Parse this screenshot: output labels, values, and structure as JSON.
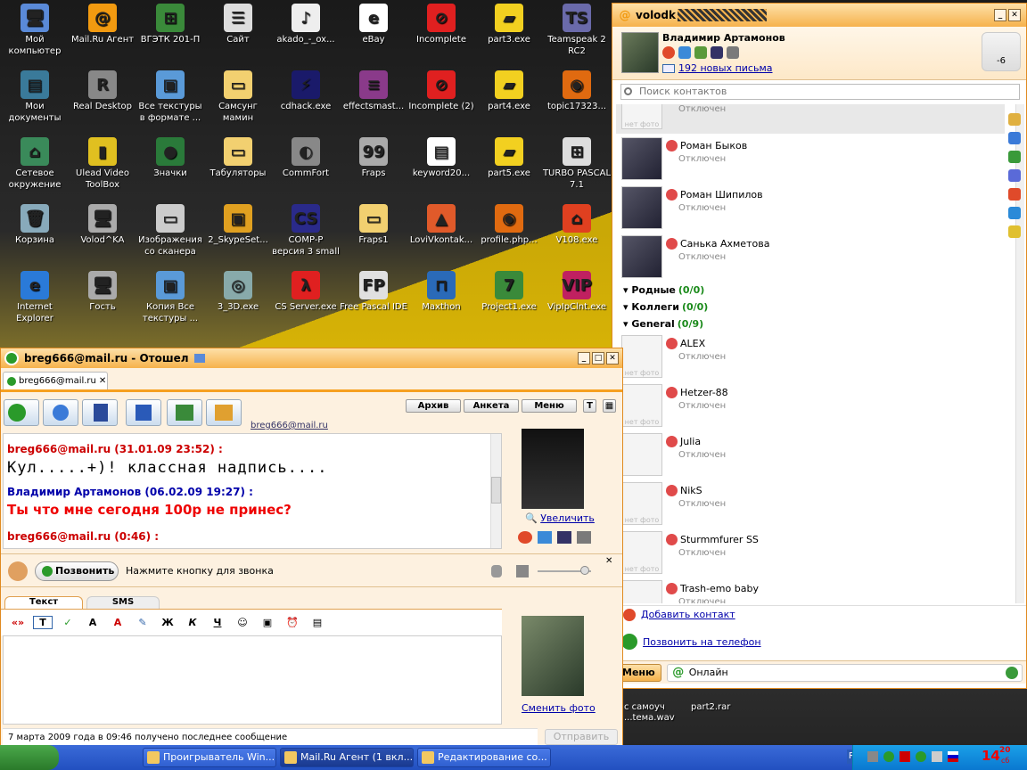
{
  "desktop": {
    "icons": [
      {
        "label": "Мой компьютер",
        "x": 0,
        "y": 0,
        "c": "#5a8ad8",
        "g": "🖥"
      },
      {
        "label": "Mail.Ru Агент",
        "x": 1,
        "y": 0,
        "c": "#f29a10",
        "g": "@"
      },
      {
        "label": "ВГЭТК 201-П",
        "x": 2,
        "y": 0,
        "c": "#3a8a3a",
        "g": "⊞"
      },
      {
        "label": "Сайт",
        "x": 3,
        "y": 0,
        "c": "#ddd",
        "g": "☰"
      },
      {
        "label": "akado_-_ox...",
        "x": 4,
        "y": 0,
        "c": "#eee",
        "g": "♪"
      },
      {
        "label": "eBay",
        "x": 5,
        "y": 0,
        "c": "#fff",
        "g": "e"
      },
      {
        "label": "Incomplete",
        "x": 6,
        "y": 0,
        "c": "#e02020",
        "g": "⊘"
      },
      {
        "label": "part3.exe",
        "x": 7,
        "y": 0,
        "c": "#f2d020",
        "g": "▰"
      },
      {
        "label": "Teamspeak 2 RC2",
        "x": 8,
        "y": 0,
        "c": "#6a6aaa",
        "g": "TS"
      },
      {
        "label": "Мои документы",
        "x": 0,
        "y": 1,
        "c": "#3a7a9a",
        "g": "▤"
      },
      {
        "label": "Real Desktop",
        "x": 1,
        "y": 1,
        "c": "#888",
        "g": "R"
      },
      {
        "label": "Все текстуры в формате ...",
        "x": 2,
        "y": 1,
        "c": "#5a9ad8",
        "g": "▣"
      },
      {
        "label": "Самсунг мамин",
        "x": 3,
        "y": 1,
        "c": "#f2d070",
        "g": "▭"
      },
      {
        "label": "cdhack.exe",
        "x": 4,
        "y": 1,
        "c": "#1a1a6a",
        "g": "⚡"
      },
      {
        "label": "effectsmast...",
        "x": 5,
        "y": 1,
        "c": "#8a3a8a",
        "g": "≡"
      },
      {
        "label": "Incomplete (2)",
        "x": 6,
        "y": 1,
        "c": "#e02020",
        "g": "⊘"
      },
      {
        "label": "part4.exe",
        "x": 7,
        "y": 1,
        "c": "#f2d020",
        "g": "▰"
      },
      {
        "label": "topic17323...",
        "x": 8,
        "y": 1,
        "c": "#e06a10",
        "g": "◉"
      },
      {
        "label": "Сетевое окружение",
        "x": 0,
        "y": 2,
        "c": "#3a8a5a",
        "g": "⌂"
      },
      {
        "label": "Ulead Video ToolBox",
        "x": 1,
        "y": 2,
        "c": "#e0c020",
        "g": "▮"
      },
      {
        "label": "Значки",
        "x": 2,
        "y": 2,
        "c": "#2a7a3a",
        "g": "●"
      },
      {
        "label": "Табуляторы",
        "x": 3,
        "y": 2,
        "c": "#f2d070",
        "g": "▭"
      },
      {
        "label": "CommFort",
        "x": 4,
        "y": 2,
        "c": "#888",
        "g": "◐"
      },
      {
        "label": "Fraps",
        "x": 5,
        "y": 2,
        "c": "#aaa",
        "g": "99"
      },
      {
        "label": "keyword20...",
        "x": 6,
        "y": 2,
        "c": "#fff",
        "g": "▤"
      },
      {
        "label": "part5.exe",
        "x": 7,
        "y": 2,
        "c": "#f2d020",
        "g": "▰"
      },
      {
        "label": "TURBO PASCAL 7.1",
        "x": 8,
        "y": 2,
        "c": "#ddd",
        "g": "⊞"
      },
      {
        "label": "Корзина",
        "x": 0,
        "y": 3,
        "c": "#8ab",
        "g": "🗑"
      },
      {
        "label": "Volod^KA",
        "x": 1,
        "y": 3,
        "c": "#aaa",
        "g": "🖥"
      },
      {
        "label": "Изображения со сканера",
        "x": 2,
        "y": 3,
        "c": "#ccc",
        "g": "▭"
      },
      {
        "label": "2_SkypeSet...",
        "x": 3,
        "y": 3,
        "c": "#e0a020",
        "g": "▣"
      },
      {
        "label": "COMP-P версия 3 small",
        "x": 4,
        "y": 3,
        "c": "#2a2a8a",
        "g": "CS"
      },
      {
        "label": "Fraps1",
        "x": 5,
        "y": 3,
        "c": "#f2d070",
        "g": "▭"
      },
      {
        "label": "LoviVkontak...",
        "x": 6,
        "y": 3,
        "c": "#e05a2a",
        "g": "▲"
      },
      {
        "label": "profile.php...",
        "x": 7,
        "y": 3,
        "c": "#e06a10",
        "g": "◉"
      },
      {
        "label": "V108.exe",
        "x": 8,
        "y": 3,
        "c": "#e04020",
        "g": "⌂"
      },
      {
        "label": "Internet Explorer",
        "x": 0,
        "y": 4,
        "c": "#2a7ad8",
        "g": "e"
      },
      {
        "label": "Гость",
        "x": 1,
        "y": 4,
        "c": "#aaa",
        "g": "🖥"
      },
      {
        "label": "Копия Все текстуры ...",
        "x": 2,
        "y": 4,
        "c": "#5a9ad8",
        "g": "▣"
      },
      {
        "label": "3_3D.exe",
        "x": 3,
        "y": 4,
        "c": "#8aa",
        "g": "◎"
      },
      {
        "label": "CS Server.exe",
        "x": 4,
        "y": 4,
        "c": "#e02020",
        "g": "λ"
      },
      {
        "label": "Free Pascal IDE",
        "x": 5,
        "y": 4,
        "c": "#e0e0e0",
        "g": "FP"
      },
      {
        "label": "Maxthon",
        "x": 6,
        "y": 4,
        "c": "#2a6ab8",
        "g": "⊓"
      },
      {
        "label": "Project1.exe",
        "x": 7,
        "y": 4,
        "c": "#3a8a3a",
        "g": "7"
      },
      {
        "label": "VipIpClnt.exe",
        "x": 8,
        "y": 4,
        "c": "#c02060",
        "g": "VIP"
      }
    ],
    "bottom_icons": [
      "с самоуч ...tема.wav",
      "part2.rar"
    ]
  },
  "contact_window": {
    "title": "volodk",
    "profile_name": "Владимир Артамонов",
    "new_mail": "192 новых письма",
    "weather": "-6",
    "search_placeholder": "Поиск контактов",
    "contacts": [
      {
        "name": "",
        "status": "Отключен",
        "nophoto": "нет фото"
      },
      {
        "name": "Роман Быков",
        "status": "Отключен"
      },
      {
        "name": "Роман Шипилов",
        "status": "Отключен"
      },
      {
        "name": "Санька Ахметова",
        "status": "Отключен"
      }
    ],
    "groups": [
      {
        "name": "Родные",
        "count": "(0/0)"
      },
      {
        "name": "Коллеги",
        "count": "(0/0)"
      },
      {
        "name": "General",
        "count": "(0/9)"
      }
    ],
    "general_contacts": [
      {
        "name": "ALEX",
        "status": "Отключен",
        "nophoto": "нет фото"
      },
      {
        "name": "Hetzer-88",
        "status": "Отключен",
        "nophoto": "нет фото"
      },
      {
        "name": "Julia",
        "status": "Отключен",
        "nophoto": ""
      },
      {
        "name": "NikS",
        "status": "Отключен",
        "nophoto": "нет фото"
      },
      {
        "name": "Sturmmfurer SS",
        "status": "Отключен",
        "nophoto": "нет фото"
      },
      {
        "name": "Trash-emo baby",
        "status": "Отключен",
        "nophoto": "нет фото"
      }
    ],
    "add_contact": "Добавить контакт",
    "call_phone": "Позвонить на телефон",
    "menu": "Меню",
    "online_status": "Онлайн"
  },
  "chat_window": {
    "title": "breg666@mail.ru - Отошел",
    "tab": "breg666@mail.ru",
    "archive": "Архив",
    "profile": "Анкета",
    "menu": "Меню",
    "peer_label": "breg666@mail.ru",
    "messages": [
      {
        "from": "breg666@mail.ru (31.01.09 23:52) :",
        "text": "Кул.....+)! классная надпись...."
      },
      {
        "from": "Владимир Артамонов (06.02.09 19:27) :",
        "text": "Ты что мне сегодня 100р не принес?"
      },
      {
        "from": "breg666@mail.ru (0:46) :",
        "text": ""
      }
    ],
    "enlarge": "Увеличить",
    "call_button": "Позвонить",
    "call_hint": "Нажмите кнопку для звонка",
    "tab_text": "Текст",
    "tab_sms": "SMS",
    "format_quote": "«»",
    "format_bold": "Ж",
    "format_italic": "К",
    "format_underline": "Ч",
    "change_photo": "Сменить фото",
    "status_line": "7 марта 2009 года в 09:46 получено последнее сообщение",
    "send": "Отправить"
  },
  "taskbar": {
    "buttons": [
      "Проигрыватель Win...",
      "Mail.Ru Агент (1 вкл...",
      "Редактирование со..."
    ],
    "lang": "RU",
    "clock_h": "14",
    "clock_m": "20",
    "clock_day": "сб"
  }
}
